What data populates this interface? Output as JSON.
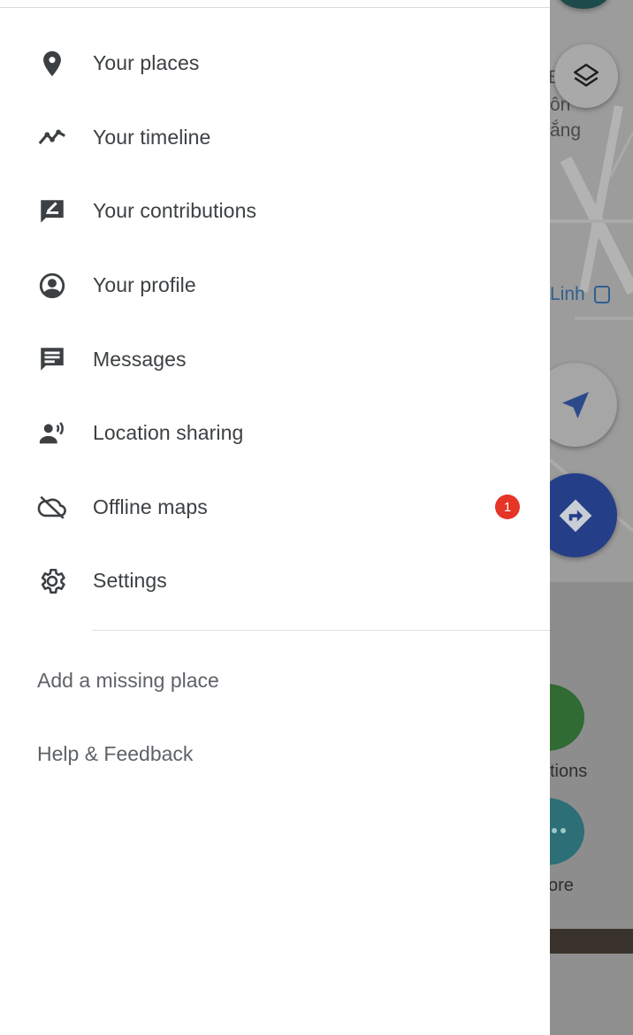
{
  "drawer": {
    "items": [
      {
        "label": "Your places",
        "icon": "location-pin-icon"
      },
      {
        "label": "Your timeline",
        "icon": "timeline-icon"
      },
      {
        "label": "Your contributions",
        "icon": "contributions-icon"
      },
      {
        "label": "Your profile",
        "icon": "profile-icon"
      },
      {
        "label": "Messages",
        "icon": "messages-icon"
      },
      {
        "label": "Location sharing",
        "icon": "location-sharing-icon"
      },
      {
        "label": "Offline maps",
        "icon": "offline-cloud-icon",
        "badge": "1"
      },
      {
        "label": "Settings",
        "icon": "gear-icon"
      }
    ],
    "footer": {
      "add_place": "Add a missing place",
      "help": "Help & Feedback"
    }
  },
  "map": {
    "labels": {
      "fragment_1": "E",
      "fragment_2": "ôn",
      "fragment_3": "ắng",
      "place": "Linh"
    },
    "sheet": {
      "label_1": "ctions",
      "label_2": "ore"
    }
  },
  "colors": {
    "badge": "#e53527",
    "directions_button": "#243f88",
    "text_primary": "#3c4043"
  }
}
